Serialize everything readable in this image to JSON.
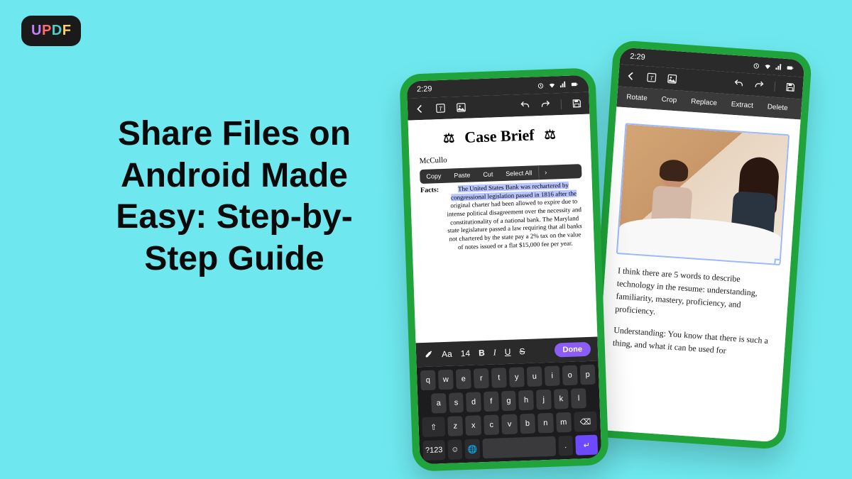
{
  "logo": {
    "u": "U",
    "p": "P",
    "d": "D",
    "f": "F"
  },
  "headline": "Share Files on Android Made Easy: Step-by-Step Guide",
  "time": "2:29",
  "phone_front": {
    "doc_title": "Case Brief",
    "case_name": "McCullo",
    "text_menu": {
      "copy": "Copy",
      "paste": "Paste",
      "cut": "Cut",
      "select_all": "Select All"
    },
    "facts_label": "Facts:",
    "facts_highlight": "The United States Bank was rechartered by congressional legislation passed in 1816 after the ",
    "facts_rest": "original charter had been allowed to expire due to intense political disagreement over the necessity and constitutionality of a national bank. The Maryland state legislature passed a law requiring that all banks not chartered by the state pay a 2% tax on the value of notes issued or a flat $15,000 fee per year.",
    "format": {
      "font": "Aa",
      "size": "14",
      "bold": "B",
      "italic": "I",
      "underline": "U",
      "strike": "S",
      "done": "Done"
    },
    "keyboard": {
      "row1": [
        "q",
        "w",
        "e",
        "r",
        "t",
        "y",
        "u",
        "i",
        "o",
        "p"
      ],
      "row2": [
        "a",
        "s",
        "d",
        "f",
        "g",
        "h",
        "j",
        "k",
        "l"
      ],
      "row3_shift": "⇧",
      "row3": [
        "z",
        "x",
        "c",
        "v",
        "b",
        "n",
        "m"
      ],
      "row3_del": "⌫",
      "row4": {
        "num": "?123",
        "emoji": "☺",
        "globe": "🌐",
        "enter": "↵"
      }
    }
  },
  "phone_back": {
    "toolbar": {
      "rotate": "Rotate",
      "crop": "Crop",
      "replace": "Replace",
      "extract": "Extract",
      "delete": "Delete"
    },
    "para1": "I think there are 5 words to describe technology in the resume: understanding, familiarity, mastery, proficiency, and proficiency.",
    "para2": "Understanding: You know that there is such a thing, and what it can be used for"
  }
}
